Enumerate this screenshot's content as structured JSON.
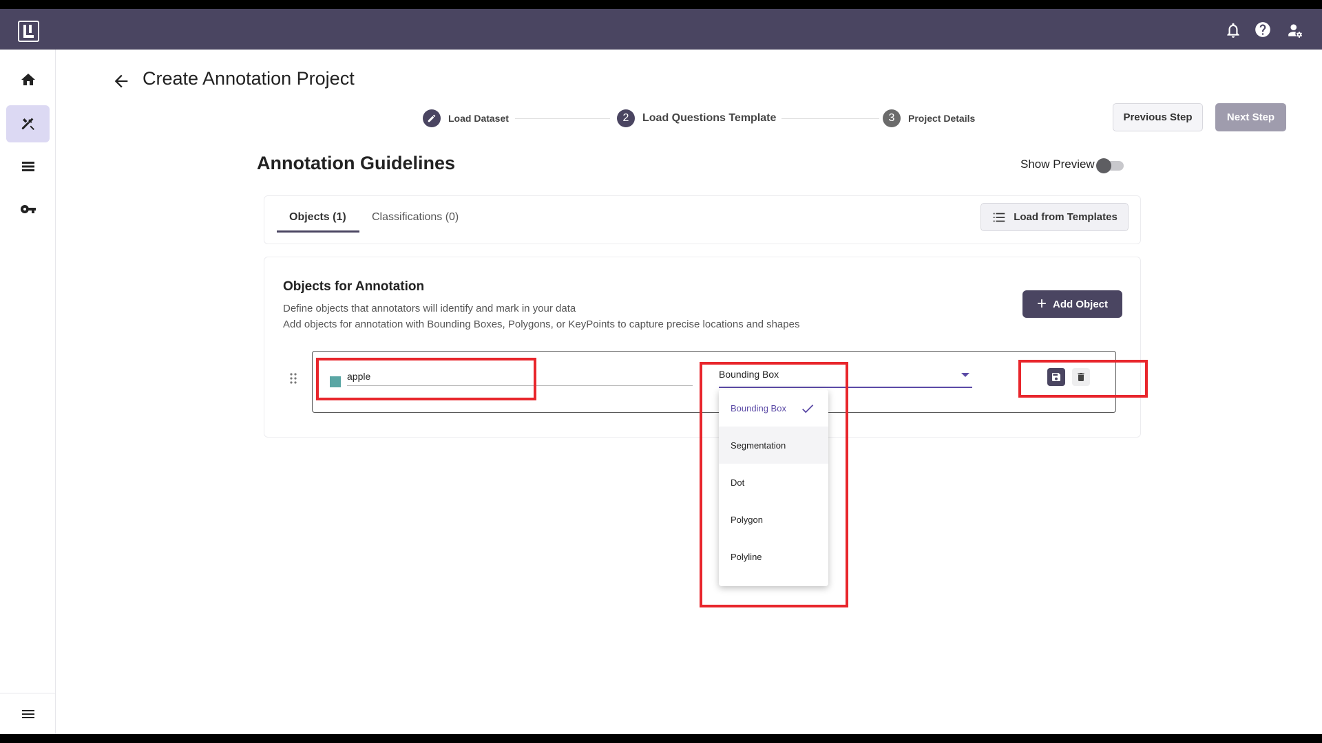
{
  "header": {
    "title": "Create Annotation Project"
  },
  "stepper": {
    "steps": [
      {
        "number": "1",
        "label": "Load Dataset"
      },
      {
        "number": "2",
        "label": "Load Questions Template"
      },
      {
        "number": "3",
        "label": "Project Details"
      }
    ],
    "previous_label": "Previous Step",
    "next_label": "Next Step"
  },
  "guidelines": {
    "title": "Annotation Guidelines",
    "show_preview_label": "Show Preview",
    "show_preview_on": false
  },
  "tabs": [
    {
      "label": "Objects (1)"
    },
    {
      "label": "Classifications (0)"
    }
  ],
  "load_templates_label": "Load from Templates",
  "objects": {
    "title": "Objects for Annotation",
    "description_line1": "Define objects that annotators will identify and mark in your data",
    "description_line2": "Add objects for annotation with Bounding Boxes, Polygons, or KeyPoints to capture precise locations and shapes",
    "add_label": "Add Object",
    "item": {
      "name": "apple",
      "color": "#5aa6a4",
      "type": "Bounding Box"
    }
  },
  "type_menu": {
    "options": [
      "Bounding Box",
      "Segmentation",
      "Dot",
      "Polygon",
      "Polyline"
    ],
    "selected": "Bounding Box"
  },
  "colors": {
    "brand": "#4a4561",
    "accent": "#5b4aa6",
    "highlight": "#e8262c"
  }
}
